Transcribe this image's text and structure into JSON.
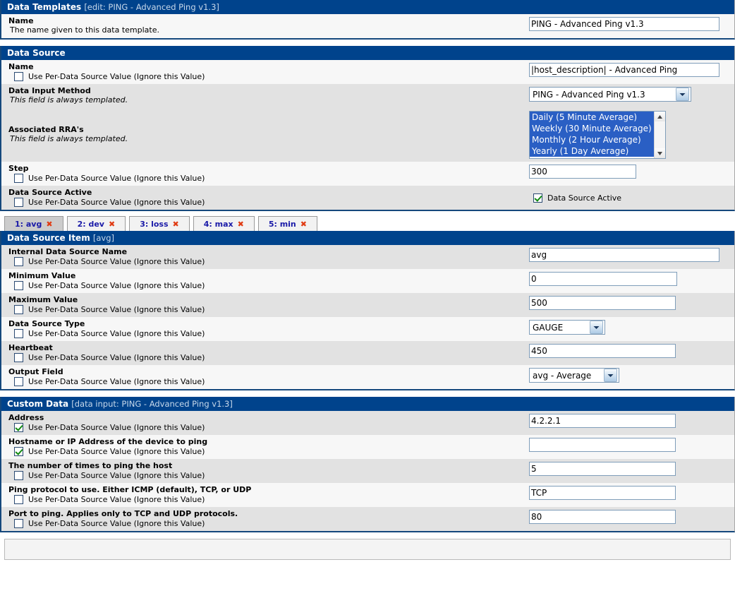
{
  "labels": {
    "per_ds_value": "Use Per-Data Source Value (Ignore this Value)",
    "always_templated": "This field is always templated."
  },
  "data_templates": {
    "header_title": "Data Templates",
    "header_sub": "[edit: PING - Advanced Ping v1.3]",
    "name": {
      "label": "Name",
      "desc": "The name given to this data template.",
      "value": "PING - Advanced Ping v1.3"
    }
  },
  "data_source": {
    "header_title": "Data Source",
    "name": {
      "label": "Name",
      "checkbox_label": "Use Per-Data Source Value (Ignore this Value)",
      "checked": false,
      "value": "|host_description| - Advanced Ping"
    },
    "data_input_method": {
      "label": "Data Input Method",
      "desc": "This field is always templated.",
      "value": "PING - Advanced Ping v1.3"
    },
    "associated_rras": {
      "label": "Associated RRA's",
      "desc": "This field is always templated.",
      "options": [
        {
          "label": "Daily (5 Minute Average)",
          "selected": true
        },
        {
          "label": "Weekly (30 Minute Average)",
          "selected": true
        },
        {
          "label": "Monthly (2 Hour Average)",
          "selected": true
        },
        {
          "label": "Yearly (1 Day Average)",
          "selected": true
        }
      ]
    },
    "step": {
      "label": "Step",
      "checkbox_label": "Use Per-Data Source Value (Ignore this Value)",
      "checked": false,
      "value": "300"
    },
    "active": {
      "label": "Data Source Active",
      "checkbox_label": "Use Per-Data Source Value (Ignore this Value)",
      "checked": false,
      "field_checkbox_label": "Data Source Active",
      "field_checked": true
    }
  },
  "tabs": [
    {
      "label": "1: avg",
      "close": "✖",
      "active": true
    },
    {
      "label": "2: dev",
      "close": "✖",
      "active": false
    },
    {
      "label": "3: loss",
      "close": "✖",
      "active": false
    },
    {
      "label": "4: max",
      "close": "✖",
      "active": false
    },
    {
      "label": "5: min",
      "close": "✖",
      "active": false
    }
  ],
  "data_source_item": {
    "header_title": "Data Source Item",
    "header_sub": "[avg]",
    "internal_name": {
      "label": "Internal Data Source Name",
      "checkbox_label": "Use Per-Data Source Value (Ignore this Value)",
      "checked": false,
      "value": "avg"
    },
    "minimum_value": {
      "label": "Minimum Value",
      "checkbox_label": "Use Per-Data Source Value (Ignore this Value)",
      "checked": false,
      "value": "0"
    },
    "maximum_value": {
      "label": "Maximum Value",
      "checkbox_label": "Use Per-Data Source Value (Ignore this Value)",
      "checked": false,
      "value": "500"
    },
    "data_source_type": {
      "label": "Data Source Type",
      "checkbox_label": "Use Per-Data Source Value (Ignore this Value)",
      "checked": false,
      "value": "GAUGE"
    },
    "heartbeat": {
      "label": "Heartbeat",
      "checkbox_label": "Use Per-Data Source Value (Ignore this Value)",
      "checked": false,
      "value": "450"
    },
    "output_field": {
      "label": "Output Field",
      "checkbox_label": "Use Per-Data Source Value (Ignore this Value)",
      "checked": false,
      "value": "avg - Average"
    }
  },
  "custom_data": {
    "header_title": "Custom Data",
    "header_sub": "[data input: PING - Advanced Ping v1.3]",
    "fields": [
      {
        "label": "Address",
        "checkbox_label": "Use Per-Data Source Value (Ignore this Value)",
        "checked": true,
        "value": "4.2.2.1"
      },
      {
        "label": "Hostname or IP Address of the device to ping",
        "checkbox_label": "Use Per-Data Source Value (Ignore this Value)",
        "checked": true,
        "value": ""
      },
      {
        "label": "The number of times to ping the host",
        "checkbox_label": "Use Per-Data Source Value (Ignore this Value)",
        "checked": false,
        "value": "5"
      },
      {
        "label": "Ping protocol to use. Either ICMP (default), TCP, or UDP",
        "checkbox_label": "Use Per-Data Source Value (Ignore this Value)",
        "checked": false,
        "value": "TCP"
      },
      {
        "label": "Port to ping. Applies only to TCP and UDP protocols.",
        "checkbox_label": "Use Per-Data Source Value (Ignore this Value)",
        "checked": false,
        "value": "80"
      }
    ]
  },
  "colors": {
    "header_blue": "#00438c",
    "border_blue": "#15487c",
    "row_alt": "#e2e2e2",
    "row_norm": "#f7f7f7",
    "tab_text": "#1a1aa8",
    "tab_close": "#e03c14",
    "check_green": "#108a10",
    "listbox_selection": "#2a5fc4"
  }
}
